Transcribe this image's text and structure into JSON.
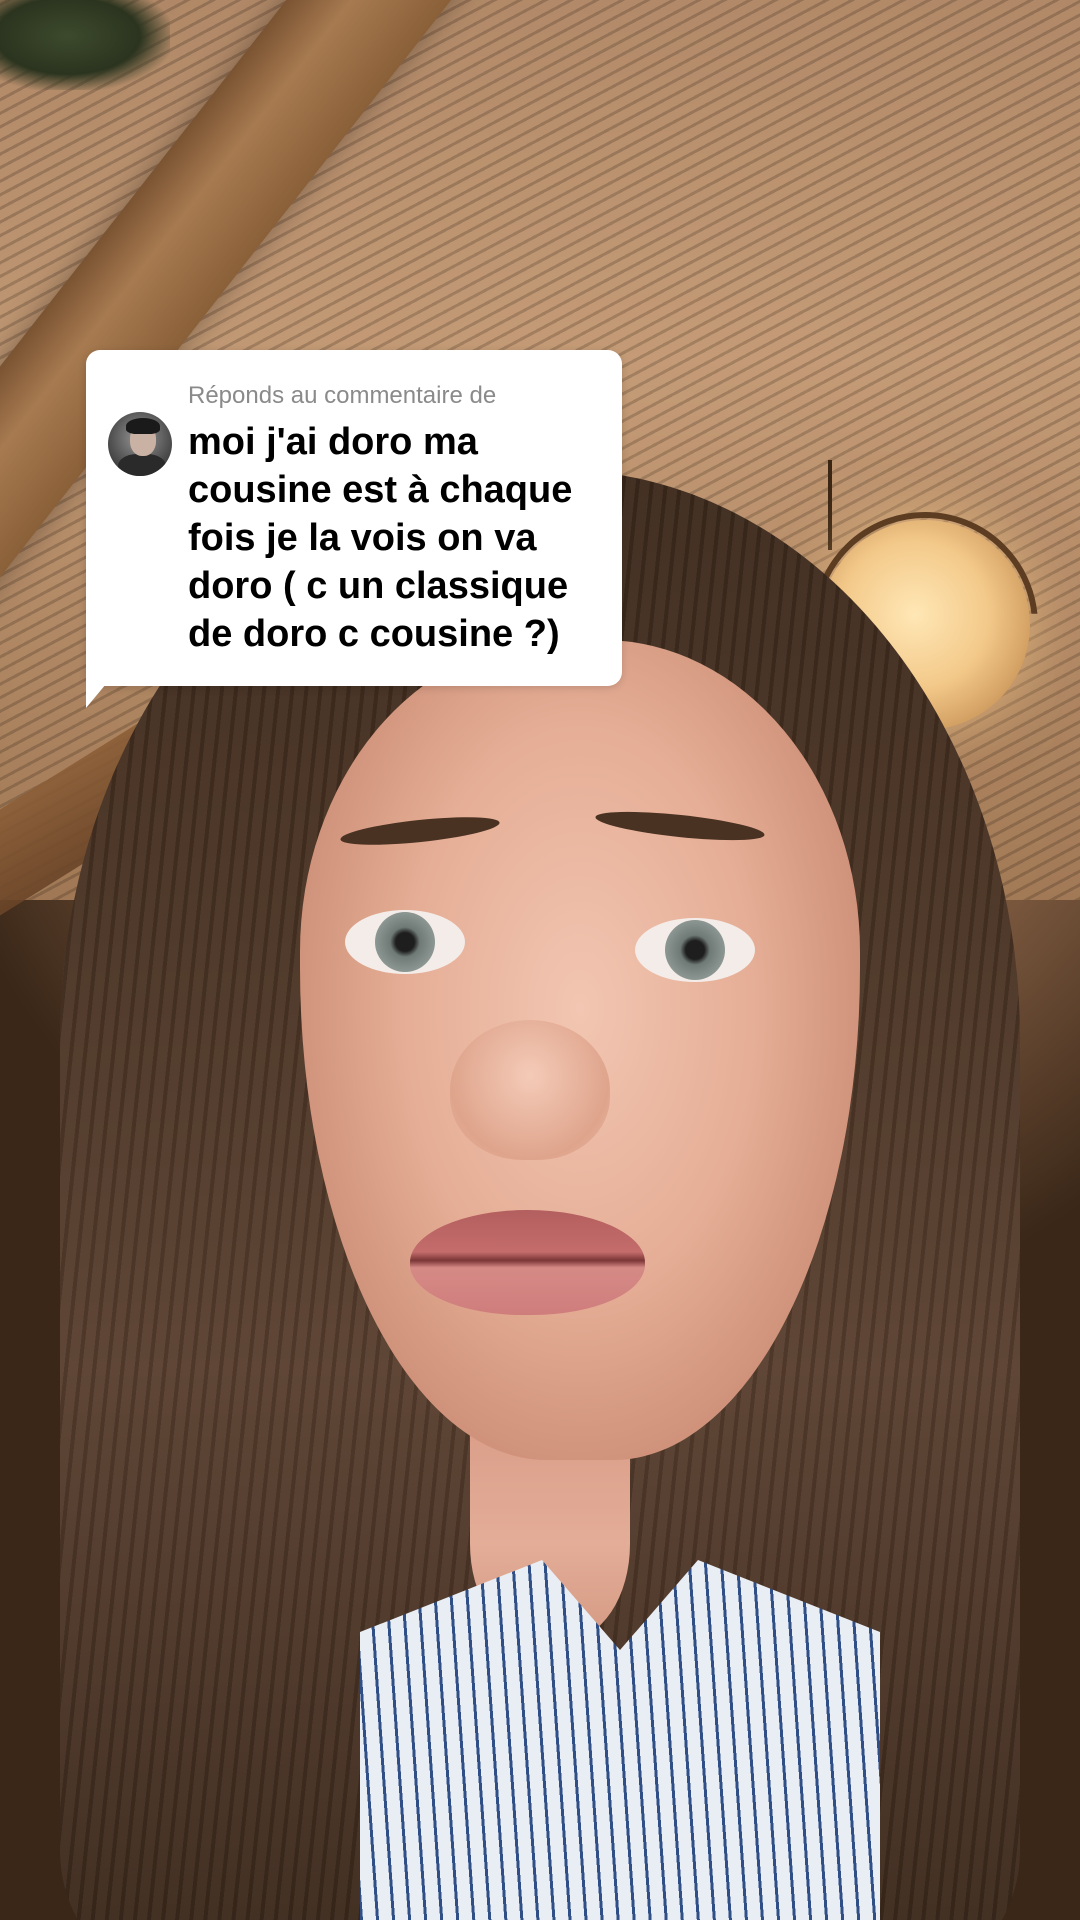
{
  "reply_sticker": {
    "header": "Réponds au commentaire de",
    "comment_lines": [
      "moi j'ai doro ma",
      "cousine est à chaque",
      "fois je la vois on va",
      "doro ( c un classique",
      "de doro c cousine ?)"
    ],
    "avatar_icon": "user-avatar",
    "background_color": "#ffffff",
    "header_color": "#8a8a8a",
    "text_color": "#000000"
  },
  "video": {
    "subject": "selfie-video-frame"
  }
}
